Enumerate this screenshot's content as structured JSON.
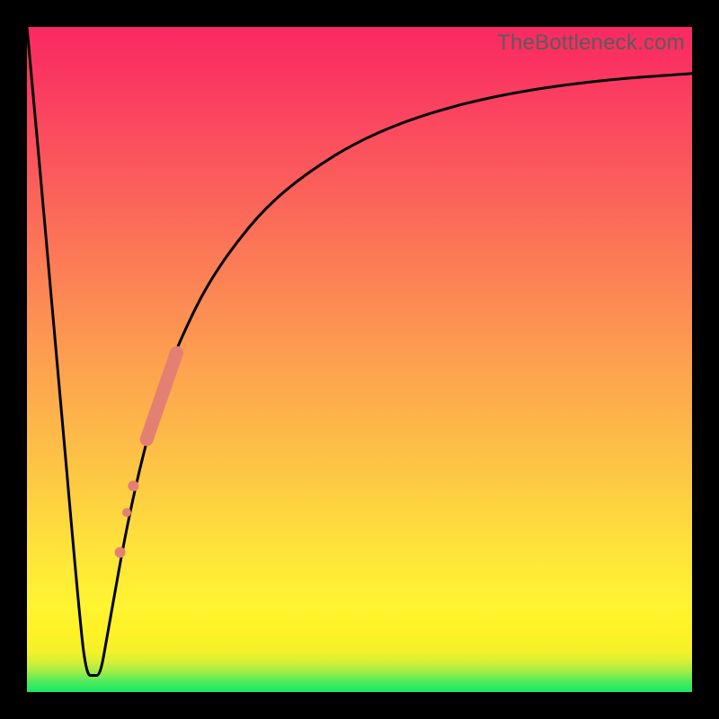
{
  "watermark": "TheBottleneck.com",
  "colors": {
    "background": "#000000",
    "curve": "#000000",
    "marker": "#e48073",
    "gradient_top": "#fa2962",
    "gradient_mid": "#fef22a",
    "gradient_bottom": "#17e966"
  },
  "chart_data": {
    "type": "line",
    "title": "",
    "xlabel": "",
    "ylabel": "",
    "xlim": [
      0,
      100
    ],
    "ylim": [
      0,
      100
    ],
    "grid": false,
    "series": [
      {
        "name": "bottleneck-curve",
        "x": [
          0,
          4,
          8,
          9,
          10,
          11,
          12,
          15,
          18,
          21,
          24,
          27,
          31,
          36,
          42,
          50,
          60,
          72,
          86,
          100
        ],
        "values": [
          100,
          56,
          10,
          2.5,
          2.5,
          2.5,
          8,
          25,
          38,
          48,
          55,
          61,
          67,
          73,
          78,
          83,
          87,
          90,
          92,
          93
        ]
      }
    ],
    "markers": [
      {
        "name": "segment-a-start",
        "x": 18.0,
        "values": 38.0,
        "size": 8
      },
      {
        "name": "segment-a-end",
        "x": 22.5,
        "values": 51.0,
        "size": 8
      },
      {
        "name": "dot-b1",
        "x": 16.0,
        "values": 31.0,
        "size": 6
      },
      {
        "name": "dot-b2",
        "x": 15.0,
        "values": 27.0,
        "size": 5
      },
      {
        "name": "dot-b3",
        "x": 14.0,
        "values": 21.0,
        "size": 6
      }
    ]
  }
}
